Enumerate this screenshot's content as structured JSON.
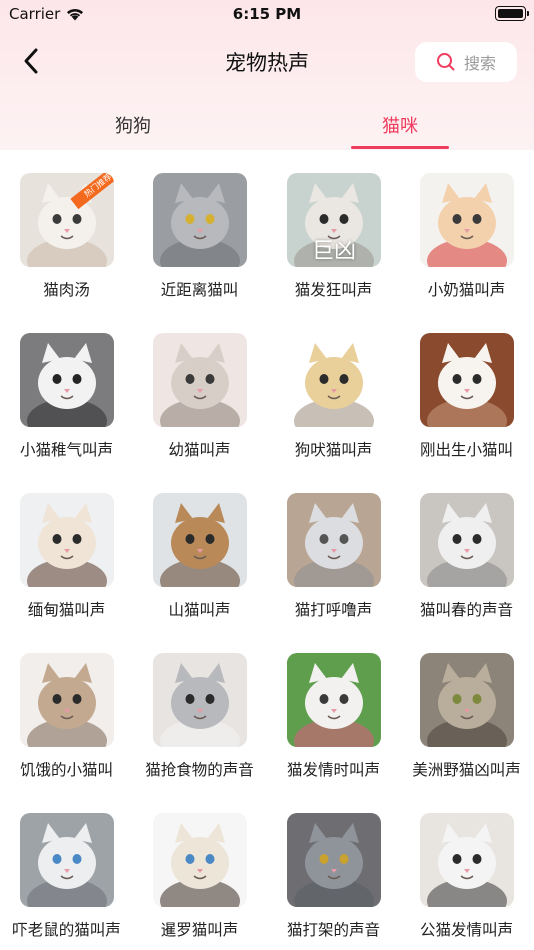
{
  "status_bar": {
    "carrier": "Carrier",
    "time": "6:15 PM"
  },
  "header": {
    "title": "宠物热声",
    "search_label": "搜索"
  },
  "tabs": [
    {
      "label": "狗狗",
      "active": false
    },
    {
      "label": "猫咪",
      "active": true
    }
  ],
  "colors": {
    "accent": "#f03c5e",
    "header_bg": "#fde6ea"
  },
  "items": [
    {
      "label": "猫肉汤",
      "badge": "热门推荐",
      "bg": "#e8e2dc",
      "fur": "#f4f1ec",
      "accent": "#c8b9a8",
      "eye": "#3b3b3b"
    },
    {
      "label": "近距离猫叫",
      "bg": "#9a9ea3",
      "fur": "#b7b9bc",
      "accent": "#6f7276",
      "eye": "#d6b030"
    },
    {
      "label": "猫发狂叫声",
      "overlay": "巨凶",
      "bg": "#c8d3cf",
      "fur": "#eae6e1",
      "accent": "#9a9890",
      "eye": "#2b2b2b"
    },
    {
      "label": "小奶猫叫声",
      "bg": "#f4f2ef",
      "fur": "#f3d1ad",
      "accent": "#d8332e",
      "eye": "#3a3a3a"
    },
    {
      "label": "小猫稚气叫声",
      "bg": "#7c7c7e",
      "fur": "#f2f2f2",
      "accent": "#2e2e30",
      "eye": "#242424"
    },
    {
      "label": "幼猫叫声",
      "bg": "#efe6e4",
      "fur": "#d7cfc7",
      "accent": "#8c8075",
      "eye": "#3a3a3a"
    },
    {
      "label": "狗吠猫叫声",
      "bg": "#ffffff",
      "fur": "#e9cf9a",
      "accent": "#9a8c7c",
      "eye": "#2b2b2b"
    },
    {
      "label": "刚出生小猫叫",
      "bg": "#8a4a2e",
      "fur": "#f7f4ef",
      "accent": "#c79b7e",
      "eye": "#2b2b2b"
    },
    {
      "label": "缅甸猫叫声",
      "bg": "#eef0f2",
      "fur": "#efe4d6",
      "accent": "#5a3a2a",
      "eye": "#2b2b2b"
    },
    {
      "label": "山猫叫声",
      "bg": "#dfe3e6",
      "fur": "#b98a58",
      "accent": "#5c3f2a",
      "eye": "#2b2b2b"
    },
    {
      "label": "猫打呼噜声",
      "bg": "#b9a594",
      "fur": "#dcdde0",
      "accent": "#8d8f93",
      "eye": "#555555"
    },
    {
      "label": "猫叫春的声音",
      "bg": "#c9c6c2",
      "fur": "#efefef",
      "accent": "#888888",
      "eye": "#2b2b2b"
    },
    {
      "label": "饥饿的小猫叫",
      "bg": "#f2eeec",
      "fur": "#c3a98f",
      "accent": "#7a6450",
      "eye": "#2b2b2b"
    },
    {
      "label": "猫抢食物的声音",
      "bg": "#e7e4e2",
      "fur": "#b8b9bd",
      "accent": "#f4f4f4",
      "eye": "#2b2b2b"
    },
    {
      "label": "猫发情时叫声",
      "bg": "#5f9e4d",
      "fur": "#f3f1ef",
      "accent": "#e05a84",
      "eye": "#3a3a3a"
    },
    {
      "label": "美洲野猫凶叫声",
      "bg": "#8c8478",
      "fur": "#b9ad9b",
      "accent": "#4d463e",
      "eye": "#7d8a3e"
    },
    {
      "label": "吓老鼠的猫叫声",
      "bg": "#9ea3a8",
      "fur": "#eceef0",
      "accent": "#6d7075",
      "eye": "#4a88c6"
    },
    {
      "label": "暹罗猫叫声",
      "bg": "#f6f6f6",
      "fur": "#ece5d8",
      "accent": "#3d2d22",
      "eye": "#4a88c6"
    },
    {
      "label": "猫打架的声音",
      "bg": "#6e6e72",
      "fur": "#8f949b",
      "accent": "#5a5e64",
      "eye": "#c9a12e"
    },
    {
      "label": "公猫发情叫声",
      "bg": "#e8e4df",
      "fur": "#f4f4f4",
      "accent": "#3a3a3a",
      "eye": "#2b2b2b"
    }
  ]
}
